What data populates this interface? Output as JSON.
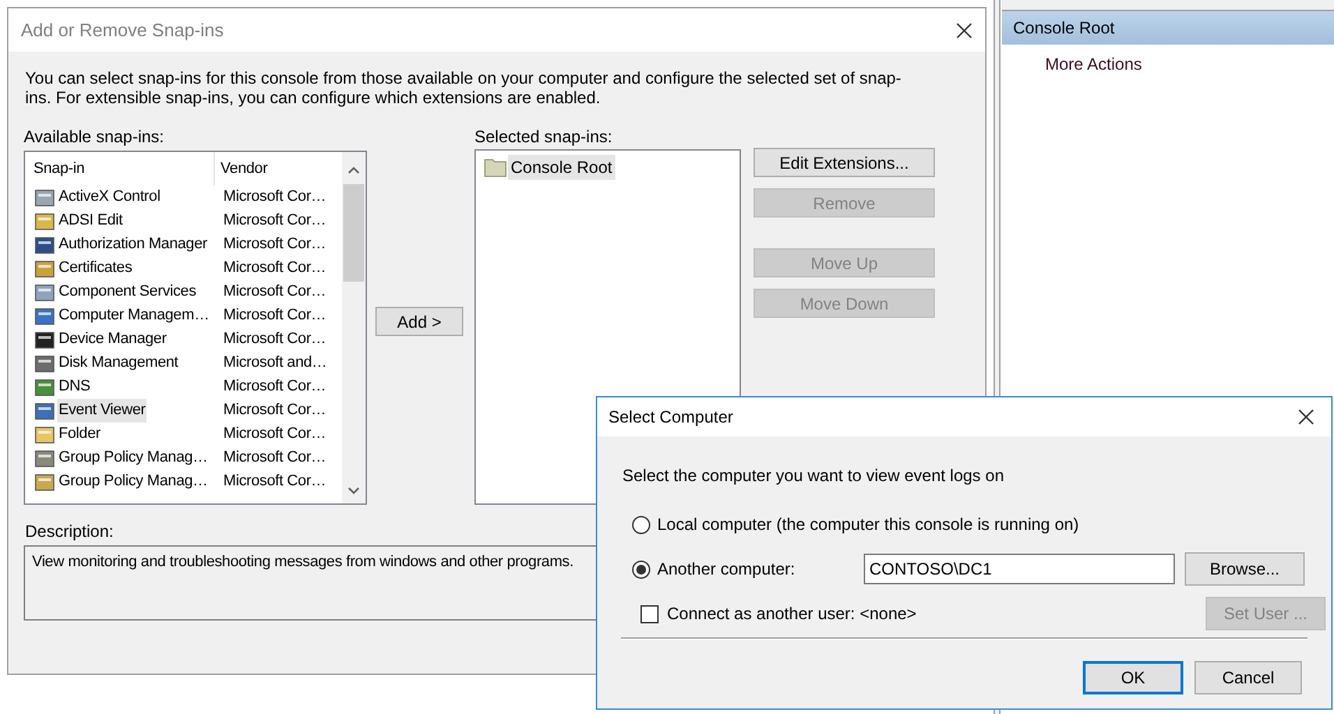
{
  "actions_pane": {
    "header": "Console Root",
    "items": [
      "More Actions"
    ]
  },
  "snapin_dialog": {
    "title": "Add or Remove Snap-ins",
    "intro": "You can select snap-ins for this console from those available on your computer and configure the selected set of snap-ins. For extensible snap-ins, you can configure which extensions are enabled.",
    "available_label": "Available snap-ins:",
    "columns": [
      "Snap-in",
      "Vendor"
    ],
    "rows": [
      {
        "name": "ActiveX Control",
        "vendor": "Microsoft Cor…",
        "selected": false
      },
      {
        "name": "ADSI Edit",
        "vendor": "Microsoft Cor…",
        "selected": false
      },
      {
        "name": "Authorization Manager",
        "vendor": "Microsoft Cor…",
        "selected": false
      },
      {
        "name": "Certificates",
        "vendor": "Microsoft Cor…",
        "selected": false
      },
      {
        "name": "Component Services",
        "vendor": "Microsoft Cor…",
        "selected": false
      },
      {
        "name": "Computer Managem…",
        "vendor": "Microsoft Cor…",
        "selected": false
      },
      {
        "name": "Device Manager",
        "vendor": "Microsoft Cor…",
        "selected": false
      },
      {
        "name": "Disk Management",
        "vendor": "Microsoft and…",
        "selected": false
      },
      {
        "name": "DNS",
        "vendor": "Microsoft Cor…",
        "selected": false
      },
      {
        "name": "Event Viewer",
        "vendor": "Microsoft Cor…",
        "selected": true
      },
      {
        "name": "Folder",
        "vendor": "Microsoft Cor…",
        "selected": false
      },
      {
        "name": "Group Policy Manag…",
        "vendor": "Microsoft Cor…",
        "selected": false
      },
      {
        "name": "Group Policy Manag…",
        "vendor": "Microsoft Cor…",
        "selected": false
      }
    ],
    "add_button": "Add >",
    "selected_label": "Selected snap-ins:",
    "selected_items": [
      {
        "label": "Console Root",
        "selected": true
      }
    ],
    "side_buttons": [
      {
        "label": "Edit Extensions...",
        "disabled": false
      },
      {
        "label": "Remove",
        "disabled": true
      },
      {
        "label": "Move Up",
        "disabled": true
      },
      {
        "label": "Move Down",
        "disabled": true
      }
    ],
    "description_label": "Description:",
    "description": "View monitoring and troubleshooting messages from windows and other programs."
  },
  "select_computer": {
    "title": "Select Computer",
    "prompt": "Select the computer you want to view event logs on",
    "options": [
      {
        "label": "Local computer (the computer this console is running on)",
        "selected": false
      },
      {
        "label": "Another computer:",
        "selected": true
      }
    ],
    "computer_field": "CONTOSO\\DC1",
    "browse_button": "Browse...",
    "connect_as": {
      "label": "Connect as another user: <none>",
      "checked": false
    },
    "set_user_button": {
      "label": "Set User ...",
      "disabled": true
    },
    "ok_button": "OK",
    "cancel_button": "Cancel"
  }
}
